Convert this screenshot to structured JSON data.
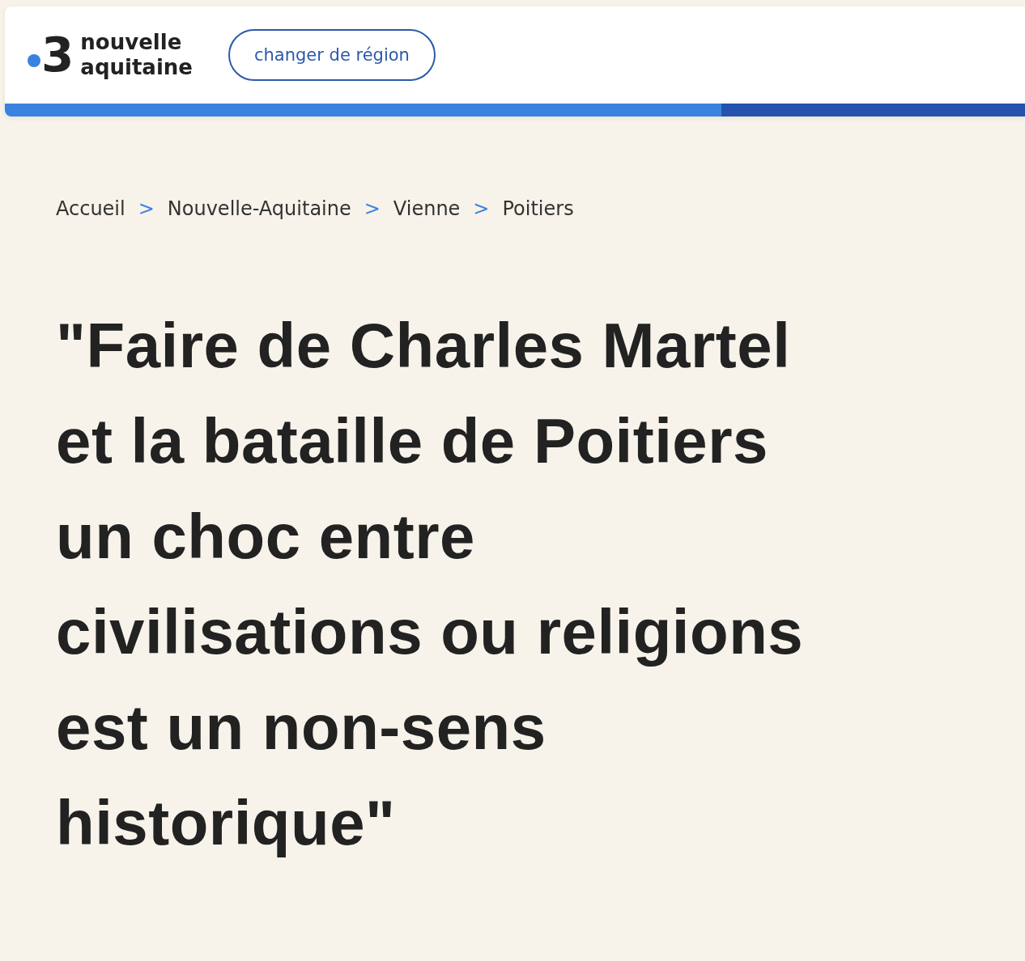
{
  "header": {
    "logo": {
      "number": "3",
      "name_lines": [
        "nouvelle",
        "aquitaine"
      ]
    },
    "region_button": "changer de région"
  },
  "breadcrumb": {
    "separator": ">",
    "items": [
      "Accueil",
      "Nouvelle-Aquitaine",
      "Vienne",
      "Poitiers"
    ]
  },
  "article": {
    "title": "\"Faire de Charles Martel\net la bataille de Poitiers\nun choc entre\ncivilisations ou religions\nest un non-sens\nhistorique\""
  }
}
